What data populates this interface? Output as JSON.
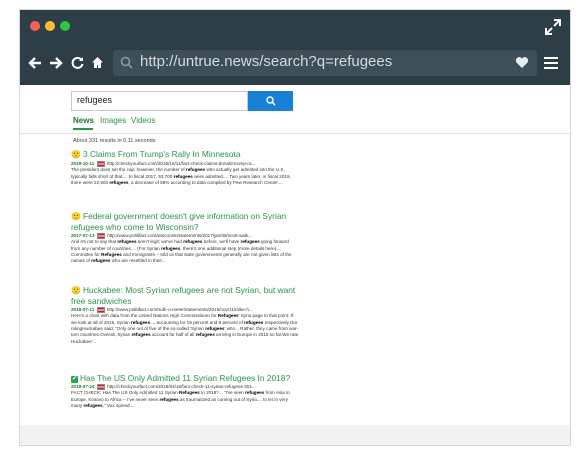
{
  "browser": {
    "url": "http://untrue.news/search?q=refugees"
  },
  "search": {
    "query": "refugees",
    "tabs": [
      "News",
      "Images",
      "Videos"
    ],
    "result_count": "About 331 results in 0.11 seconds"
  },
  "icons": {
    "expand": "expand-arrows-icon",
    "back": "arrow-left-icon",
    "forward": "arrow-right-icon",
    "reload": "reload-icon",
    "home": "home-icon",
    "search": "search-icon",
    "heart": "heart-icon",
    "menu": "hamburger-menu-icon",
    "flag": "us-flag-icon"
  },
  "colors": {
    "chrome": "#2e3e46",
    "accent_green": "#2b9348",
    "search_button": "#1a80d6"
  },
  "results": [
    {
      "badge": "🙂",
      "title": "3 Claims From Trump's Rally In Minnesota",
      "date": "2019-10-11",
      "url": "http://checkyourfact.com/2019/10/11/fact-check-claims-donald-trump-ra...",
      "snippet": "The president does set the cap; however, the number of refugees who actually get admitted into the U.S. typically falls short of that.... In fiscal 2017, 53,700 refugees were admitted.... Two years later, in fiscal 2019, there were 22,500 refugees, a decrease of 58% according to data compiled by Pew Research Center...."
    },
    {
      "badge": "🙂",
      "title": "Federal government doesn't give information on Syrian refugees who come to Wisconsin?",
      "date": "2017-07-13",
      "url": "http://www.politifact.com/wisconsin/statements/2017/jan/06/scott-walk...",
      "snippet": "And it's not to say that refugees aren't legit; we've had refugees before, we'll have refugees going forward from any number of countries.... (For Syrian refugees, there's one additional step (more details here).... Committee for Refugees and Immigrants -- told us that state governments generally are not given lists of the names of refugees who are resettled in their..."
    },
    {
      "badge": "🙂",
      "title": "Huckabee: Most Syrian refugees are not Syrian, but want free sandwiches",
      "date": "2018-07-11",
      "url": "http://www.politifact.com/truth-o-meter/statements/2015/nov/11/mike-h...",
      "snippet": "Here's a chart with data from the United Nations High Commissioner for Refugees' Syria page to that point: If we look at all of 2015, Syrian refugees..., accounting for 19 percent and 8 percent of refugees respectively.Our rulingHuckabee said, \"Only one out of five of the so-called 'Syrian refugees' who... Rather, they came from war-torn countries.Overall, Syrian refugees account for half of all refugees arriving in Europe in 2015 so far.We rate Huckabee'..."
    },
    {
      "badge": "✔",
      "title": "Has The US Only Admitted 11 Syrian Refugees In 2018?",
      "date": "2018-07-24",
      "url": "http://checkyourfact.com/2018/04/16/fact-check-11-syrian-refugees-201...",
      "snippet": "FACT CHECK: Has The US Only Admitted 11 Syrian Refugees In 2018?... \"I've seen refugees from Asia to Europe, Kosovo to Africa -- I've never seen refugees as traumatized as coming out of Syria.... to let in very many refugees,\" Vox opined...."
    }
  ]
}
